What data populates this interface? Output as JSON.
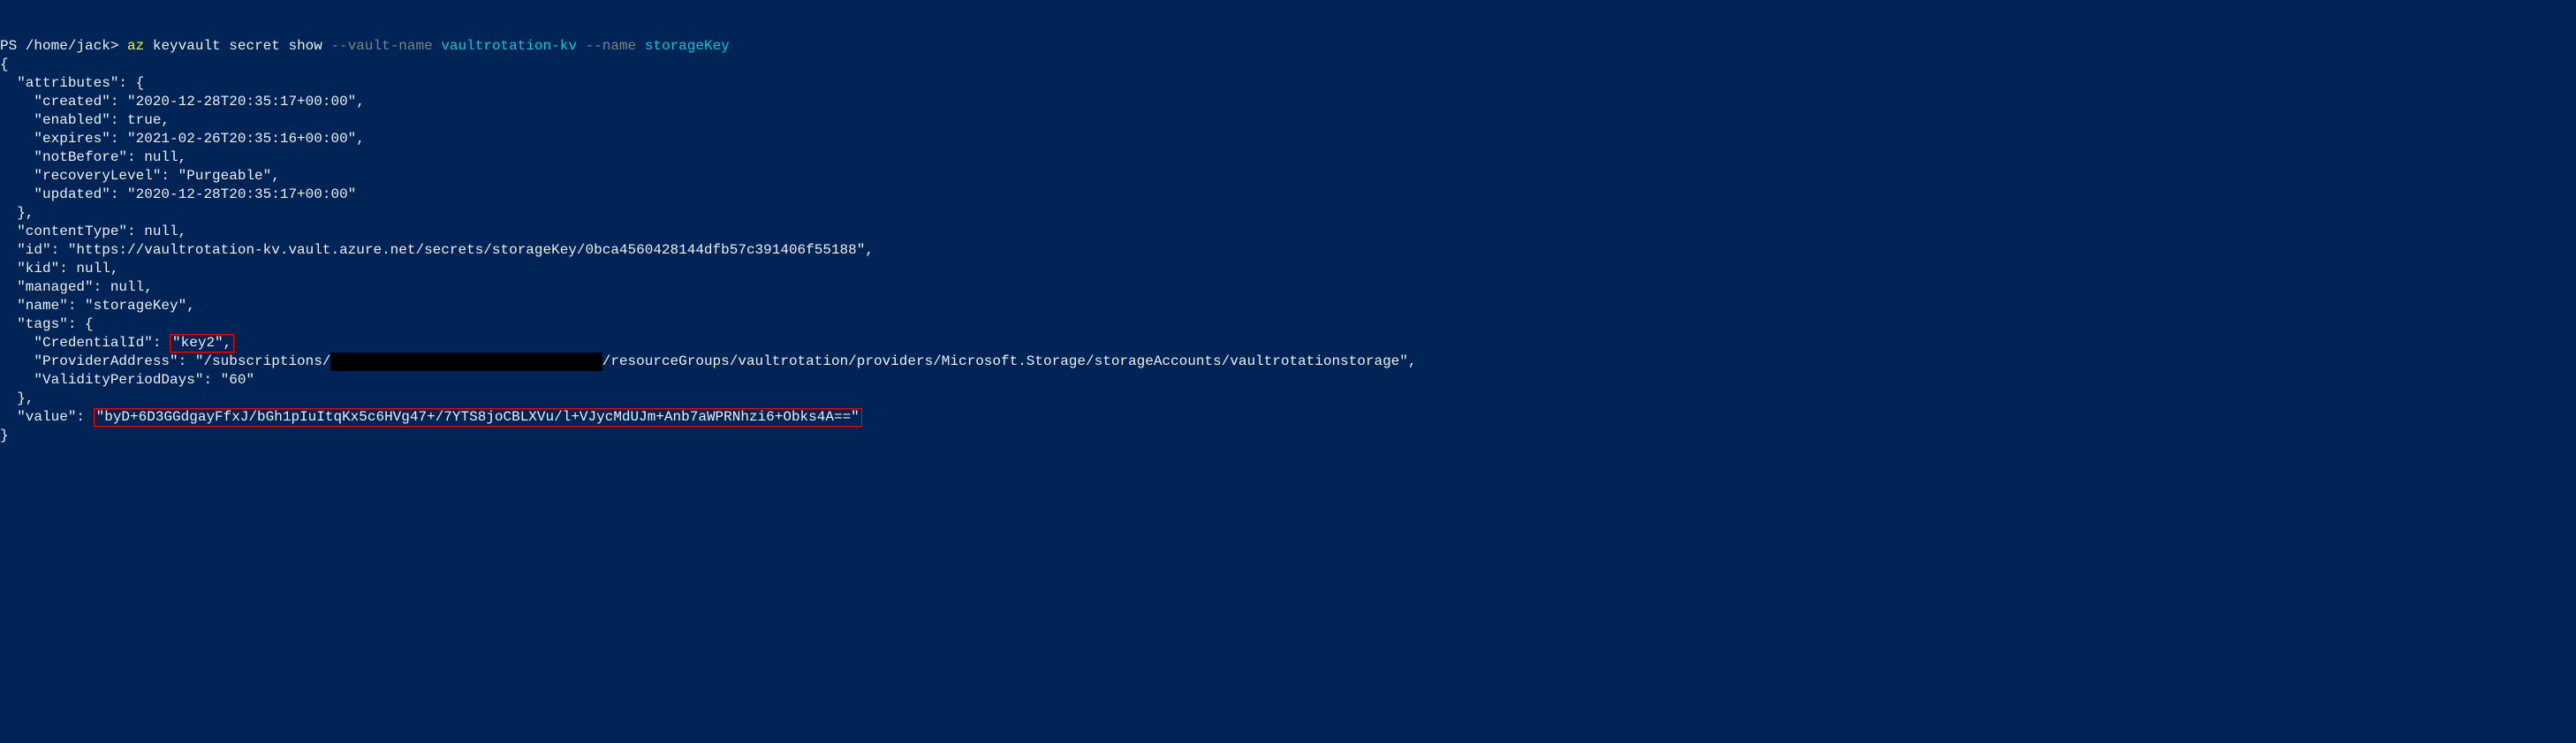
{
  "prompt": {
    "prefix": "PS /home/jack>",
    "cmd": "az",
    "args": "keyvault secret show",
    "flag1": "--vault-name",
    "val1": "vaultrotation-kv",
    "flag2": "--name",
    "val2": "storageKey"
  },
  "output": {
    "open": "{",
    "attr_key": "  \"attributes\": {",
    "created": "    \"created\": \"2020-12-28T20:35:17+00:00\",",
    "enabled": "    \"enabled\": true,",
    "expires": "    \"expires\": \"2021-02-26T20:35:16+00:00\",",
    "notBefore": "    \"notBefore\": null,",
    "recoveryLevel": "    \"recoveryLevel\": \"Purgeable\",",
    "updated": "    \"updated\": \"2020-12-28T20:35:17+00:00\"",
    "attr_close": "  },",
    "contentType": "  \"contentType\": null,",
    "id": "  \"id\": \"https://vaultrotation-kv.vault.azure.net/secrets/storageKey/0bca4560428144dfb57c391406f55188\",",
    "kid": "  \"kid\": null,",
    "managed": "  \"managed\": null,",
    "name": "  \"name\": \"storageKey\",",
    "tags_open": "  \"tags\": {",
    "cred_key": "    \"CredentialId\": ",
    "cred_val": "\"key2\",",
    "provider_pre": "    \"ProviderAddress\": \"/subscriptions/",
    "provider_redact": "                                ",
    "provider_post": "/resourceGroups/vaultrotation/providers/Microsoft.Storage/storageAccounts/vaultrotationstorage\",",
    "validity": "    \"ValidityPeriodDays\": \"60\"",
    "tags_close": "  },",
    "value_key": "  \"value\": ",
    "value_val": "\"byD+6D3GGdgayFfxJ/bGh1pIuItqKx5c6HVg47+/7YTS8joCBLXVu/l+VJycMdUJm+Anb7aWPRNhzi6+Obks4A==\"",
    "close": "}"
  }
}
